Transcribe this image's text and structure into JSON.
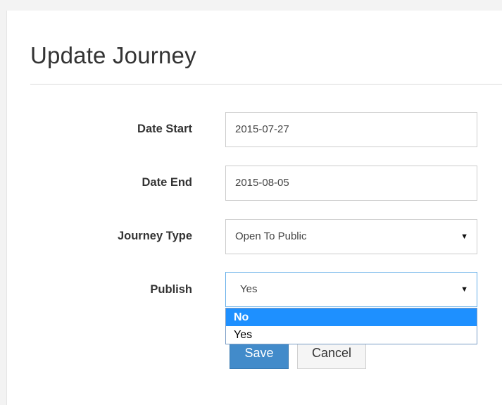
{
  "page": {
    "title": "Update Journey"
  },
  "form": {
    "date_start": {
      "label": "Date Start",
      "value": "2015-07-27"
    },
    "date_end": {
      "label": "Date End",
      "value": "2015-08-05"
    },
    "journey_type": {
      "label": "Journey Type",
      "value": "Open To Public"
    },
    "publish": {
      "label": "Publish",
      "value": "Yes",
      "options": [
        "No",
        "Yes"
      ],
      "highlighted_option": "No",
      "dropdown_open": true
    }
  },
  "buttons": {
    "save_label": "Save",
    "cancel_label": "Cancel"
  },
  "icons": {
    "select_caret": "▼"
  },
  "colors": {
    "primary": "#428bca",
    "dropdown_highlight": "#1e90ff",
    "focus_border": "#66afe9"
  }
}
